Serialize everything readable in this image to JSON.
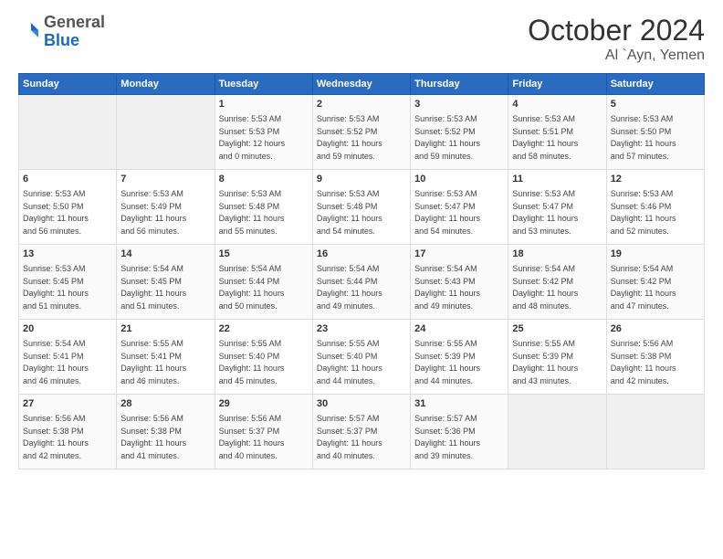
{
  "logo": {
    "general": "General",
    "blue": "Blue"
  },
  "title": "October 2024",
  "location": "Al `Ayn, Yemen",
  "days_header": [
    "Sunday",
    "Monday",
    "Tuesday",
    "Wednesday",
    "Thursday",
    "Friday",
    "Saturday"
  ],
  "weeks": [
    [
      {
        "day": "",
        "info": ""
      },
      {
        "day": "",
        "info": ""
      },
      {
        "day": "1",
        "info": "Sunrise: 5:53 AM\nSunset: 5:53 PM\nDaylight: 12 hours\nand 0 minutes."
      },
      {
        "day": "2",
        "info": "Sunrise: 5:53 AM\nSunset: 5:52 PM\nDaylight: 11 hours\nand 59 minutes."
      },
      {
        "day": "3",
        "info": "Sunrise: 5:53 AM\nSunset: 5:52 PM\nDaylight: 11 hours\nand 59 minutes."
      },
      {
        "day": "4",
        "info": "Sunrise: 5:53 AM\nSunset: 5:51 PM\nDaylight: 11 hours\nand 58 minutes."
      },
      {
        "day": "5",
        "info": "Sunrise: 5:53 AM\nSunset: 5:50 PM\nDaylight: 11 hours\nand 57 minutes."
      }
    ],
    [
      {
        "day": "6",
        "info": "Sunrise: 5:53 AM\nSunset: 5:50 PM\nDaylight: 11 hours\nand 56 minutes."
      },
      {
        "day": "7",
        "info": "Sunrise: 5:53 AM\nSunset: 5:49 PM\nDaylight: 11 hours\nand 56 minutes."
      },
      {
        "day": "8",
        "info": "Sunrise: 5:53 AM\nSunset: 5:48 PM\nDaylight: 11 hours\nand 55 minutes."
      },
      {
        "day": "9",
        "info": "Sunrise: 5:53 AM\nSunset: 5:48 PM\nDaylight: 11 hours\nand 54 minutes."
      },
      {
        "day": "10",
        "info": "Sunrise: 5:53 AM\nSunset: 5:47 PM\nDaylight: 11 hours\nand 54 minutes."
      },
      {
        "day": "11",
        "info": "Sunrise: 5:53 AM\nSunset: 5:47 PM\nDaylight: 11 hours\nand 53 minutes."
      },
      {
        "day": "12",
        "info": "Sunrise: 5:53 AM\nSunset: 5:46 PM\nDaylight: 11 hours\nand 52 minutes."
      }
    ],
    [
      {
        "day": "13",
        "info": "Sunrise: 5:53 AM\nSunset: 5:45 PM\nDaylight: 11 hours\nand 51 minutes."
      },
      {
        "day": "14",
        "info": "Sunrise: 5:54 AM\nSunset: 5:45 PM\nDaylight: 11 hours\nand 51 minutes."
      },
      {
        "day": "15",
        "info": "Sunrise: 5:54 AM\nSunset: 5:44 PM\nDaylight: 11 hours\nand 50 minutes."
      },
      {
        "day": "16",
        "info": "Sunrise: 5:54 AM\nSunset: 5:44 PM\nDaylight: 11 hours\nand 49 minutes."
      },
      {
        "day": "17",
        "info": "Sunrise: 5:54 AM\nSunset: 5:43 PM\nDaylight: 11 hours\nand 49 minutes."
      },
      {
        "day": "18",
        "info": "Sunrise: 5:54 AM\nSunset: 5:42 PM\nDaylight: 11 hours\nand 48 minutes."
      },
      {
        "day": "19",
        "info": "Sunrise: 5:54 AM\nSunset: 5:42 PM\nDaylight: 11 hours\nand 47 minutes."
      }
    ],
    [
      {
        "day": "20",
        "info": "Sunrise: 5:54 AM\nSunset: 5:41 PM\nDaylight: 11 hours\nand 46 minutes."
      },
      {
        "day": "21",
        "info": "Sunrise: 5:55 AM\nSunset: 5:41 PM\nDaylight: 11 hours\nand 46 minutes."
      },
      {
        "day": "22",
        "info": "Sunrise: 5:55 AM\nSunset: 5:40 PM\nDaylight: 11 hours\nand 45 minutes."
      },
      {
        "day": "23",
        "info": "Sunrise: 5:55 AM\nSunset: 5:40 PM\nDaylight: 11 hours\nand 44 minutes."
      },
      {
        "day": "24",
        "info": "Sunrise: 5:55 AM\nSunset: 5:39 PM\nDaylight: 11 hours\nand 44 minutes."
      },
      {
        "day": "25",
        "info": "Sunrise: 5:55 AM\nSunset: 5:39 PM\nDaylight: 11 hours\nand 43 minutes."
      },
      {
        "day": "26",
        "info": "Sunrise: 5:56 AM\nSunset: 5:38 PM\nDaylight: 11 hours\nand 42 minutes."
      }
    ],
    [
      {
        "day": "27",
        "info": "Sunrise: 5:56 AM\nSunset: 5:38 PM\nDaylight: 11 hours\nand 42 minutes."
      },
      {
        "day": "28",
        "info": "Sunrise: 5:56 AM\nSunset: 5:38 PM\nDaylight: 11 hours\nand 41 minutes."
      },
      {
        "day": "29",
        "info": "Sunrise: 5:56 AM\nSunset: 5:37 PM\nDaylight: 11 hours\nand 40 minutes."
      },
      {
        "day": "30",
        "info": "Sunrise: 5:57 AM\nSunset: 5:37 PM\nDaylight: 11 hours\nand 40 minutes."
      },
      {
        "day": "31",
        "info": "Sunrise: 5:57 AM\nSunset: 5:36 PM\nDaylight: 11 hours\nand 39 minutes."
      },
      {
        "day": "",
        "info": ""
      },
      {
        "day": "",
        "info": ""
      }
    ]
  ]
}
